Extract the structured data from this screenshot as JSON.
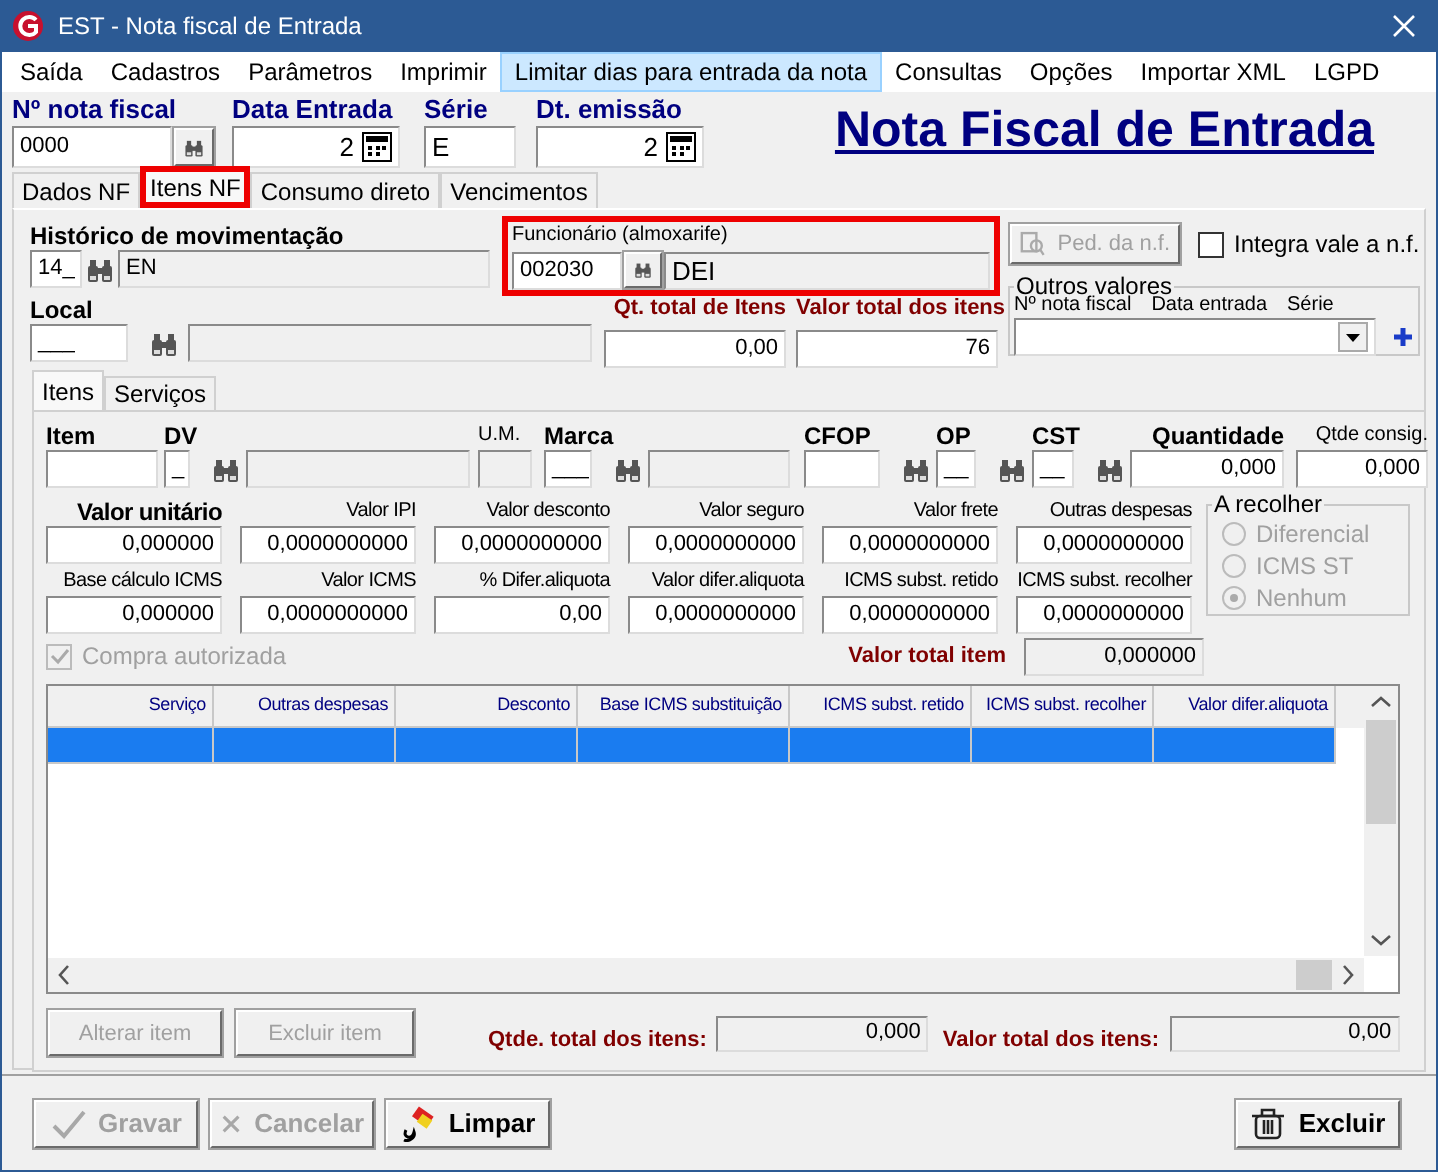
{
  "window": {
    "title": "EST - Nota fiscal de Entrada"
  },
  "menu": [
    {
      "label": "Saída",
      "selected": false
    },
    {
      "label": "Cadastros",
      "selected": false
    },
    {
      "label": "Parâmetros",
      "selected": false
    },
    {
      "label": "Imprimir",
      "selected": false
    },
    {
      "label": "Limitar dias para entrada da nota",
      "selected": true
    },
    {
      "label": "Consultas",
      "selected": false
    },
    {
      "label": "Opções",
      "selected": false
    },
    {
      "label": "Importar XML",
      "selected": false
    },
    {
      "label": "LGPD",
      "selected": false
    }
  ],
  "header": {
    "fields": [
      {
        "label": "Nº nota fiscal",
        "value": "0000",
        "kind": "lookup"
      },
      {
        "label": "Data Entrada",
        "value": "2",
        "kind": "date"
      },
      {
        "label": "Série",
        "value": "E",
        "kind": "text"
      },
      {
        "label": "Dt. emissão",
        "value": "2",
        "kind": "date"
      }
    ],
    "heading": "Nota Fiscal de Entrada"
  },
  "tabs": [
    {
      "label": "Dados NF",
      "selected": false,
      "highlighted": false
    },
    {
      "label": "Itens NF",
      "selected": true,
      "highlighted": true
    },
    {
      "label": "Consumo direto",
      "selected": false,
      "highlighted": false
    },
    {
      "label": "Vencimentos",
      "selected": false,
      "highlighted": false
    }
  ],
  "historico": {
    "label": "Histórico de movimentação",
    "code": "14_",
    "description": "EN"
  },
  "funcionario": {
    "label": "Funcionário (almoxarife)",
    "code": "002030",
    "name": "DEI",
    "highlighted": true
  },
  "pedido_button": {
    "label": "Ped. da n.f.",
    "disabled": true
  },
  "integra_vale": {
    "label": "Integra vale a n.f.",
    "checked": false
  },
  "local": {
    "label": "Local",
    "code": "___"
  },
  "totals": [
    {
      "label": "Qt. total de Itens",
      "value": "0,00"
    },
    {
      "label": "Valor total dos itens",
      "value": "76"
    }
  ],
  "outros_valores": {
    "title": "Outros valores",
    "columns": [
      "Nº nota fiscal",
      "Data entrada",
      "Série"
    ]
  },
  "item_tabs": [
    {
      "label": "Itens",
      "selected": true
    },
    {
      "label": "Serviços",
      "selected": false
    }
  ],
  "item_fields": [
    {
      "label": "Item",
      "bold": true,
      "kind": "input"
    },
    {
      "label": "DV",
      "value": "_",
      "bold": true,
      "kind": "lookup"
    },
    {
      "kind": "readonly"
    },
    {
      "label": "U.M.",
      "bold": false,
      "kind": "readonly"
    },
    {
      "label": "Marca",
      "value": "___",
      "bold": true,
      "kind": "lookup"
    },
    {
      "kind": "readonly"
    },
    {
      "label": "CFOP",
      "bold": true,
      "kind": "lookup"
    },
    {
      "label": "OP",
      "value": "__",
      "bold": true,
      "kind": "lookup"
    },
    {
      "label": "CST",
      "value": "__",
      "bold": true,
      "kind": "lookup"
    },
    {
      "label": "Quantidade",
      "value": "0,000",
      "bold": true,
      "kind": "input"
    },
    {
      "label": "Qtde consig.",
      "value": "0,000",
      "bold": false,
      "kind": "input"
    }
  ],
  "value_rows": [
    {
      "fields": [
        {
          "label": "Valor unitário",
          "value": "0,000000",
          "bold": true
        },
        {
          "label": "Valor IPI",
          "value": "0,0000000000",
          "bold": false
        },
        {
          "label": "Valor desconto",
          "value": "0,0000000000",
          "bold": false
        },
        {
          "label": "Valor seguro",
          "value": "0,0000000000",
          "bold": false
        },
        {
          "label": "Valor frete",
          "value": "0,0000000000",
          "bold": false
        },
        {
          "label": "Outras despesas",
          "value": "0,0000000000",
          "bold": false
        }
      ]
    },
    {
      "fields": [
        {
          "label": "Base cálculo ICMS",
          "value": "0,000000",
          "bold": false
        },
        {
          "label": "Valor ICMS",
          "value": "0,0000000000",
          "bold": false
        },
        {
          "label": "% Difer.aliquota",
          "value": "0,00",
          "bold": false
        },
        {
          "label": "Valor difer.aliquota",
          "value": "0,0000000000",
          "bold": false
        },
        {
          "label": "ICMS subst. retido",
          "value": "0,0000000000",
          "bold": false
        },
        {
          "label": "ICMS subst. recolher",
          "value": "0,0000000000",
          "bold": false
        }
      ]
    }
  ],
  "a_recolher": {
    "title": "A recolher",
    "disabled": true,
    "options": [
      {
        "label": "Diferencial",
        "selected": false
      },
      {
        "label": "ICMS ST",
        "selected": false
      },
      {
        "label": "Nenhum",
        "selected": true
      }
    ]
  },
  "compra_autorizada": {
    "label": "Compra autorizada",
    "checked": true,
    "disabled": true
  },
  "valor_total_item": {
    "label": "Valor total item",
    "value": "0,000000"
  },
  "grid": {
    "columns": [
      "Serviço",
      "Outras despesas",
      "Desconto",
      "Base ICMS substituição",
      "ICMS subst. retido",
      "ICMS subst. recolher",
      "Valor difer.aliquota"
    ],
    "rows": [
      {
        "selected": true
      }
    ]
  },
  "item_buttons": [
    {
      "label": "Alterar item",
      "disabled": true
    },
    {
      "label": "Excluir item",
      "disabled": true
    }
  ],
  "item_totals": [
    {
      "label": "Qtde. total dos itens:",
      "value": "0,000"
    },
    {
      "label": "Valor total dos itens:",
      "value": "0,00"
    }
  ],
  "footer_buttons": [
    {
      "label": "Gravar",
      "kind": "save",
      "disabled": true
    },
    {
      "label": "Cancelar",
      "kind": "cancel",
      "disabled": true
    },
    {
      "label": "Limpar",
      "kind": "clear",
      "disabled": false
    },
    {
      "label": "Excluir",
      "kind": "delete",
      "disabled": false
    }
  ]
}
